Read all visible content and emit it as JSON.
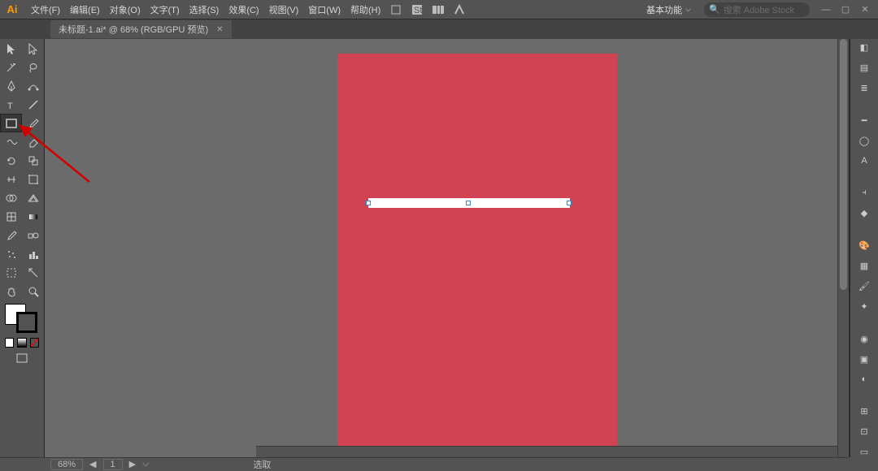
{
  "app_logo": "Ai",
  "menu": {
    "file": "文件(F)",
    "edit": "编辑(E)",
    "object": "对象(O)",
    "text": "文字(T)",
    "select": "选择(S)",
    "effect": "效果(C)",
    "view": "视图(V)",
    "window": "窗口(W)",
    "help": "帮助(H)"
  },
  "workspace_switch": "基本功能",
  "search_placeholder": "搜索 Adobe Stock",
  "tab_title": "未标题-1.ai* @ 68% (RGB/GPU 预览)",
  "status": {
    "zoom": "68%",
    "page": "1",
    "arrow_l": "◀",
    "arrow_r": "▶",
    "pages_menu": "⌵",
    "label": "选取"
  },
  "toolbox_names": [
    [
      "selection-tool",
      "direct-selection-tool"
    ],
    [
      "magic-wand-tool",
      "lasso-tool"
    ],
    [
      "pen-tool",
      "curvature-tool"
    ],
    [
      "text-tool",
      "line-tool"
    ],
    [
      "rectangle-tool",
      "paintbrush-tool"
    ],
    [
      "shaper-tool",
      "eraser-tool"
    ],
    [
      "rotate-tool",
      "scale-tool"
    ],
    [
      "width-tool",
      "free-transform-tool"
    ],
    [
      "shape-builder-tool",
      "perspective-grid-tool"
    ],
    [
      "mesh-tool",
      "gradient-tool"
    ],
    [
      "eyedropper-tool",
      "blend-tool"
    ],
    [
      "symbol-sprayer-tool",
      "column-graph-tool"
    ],
    [
      "artboard-tool",
      "slice-tool"
    ],
    [
      "hand-tool",
      "zoom-tool"
    ]
  ],
  "right_icons": [
    "layers-icon",
    "libraries-icon",
    "properties-icon",
    "stroke-icon",
    "circle-icon",
    "text-icon",
    "align-icon",
    "pathfinder-icon",
    "color-icon",
    "swatches-icon",
    "brushes-icon",
    "symbols-icon",
    "appearance-icon",
    "graphic-styles-icon",
    "transparency-icon",
    "info-icon",
    "navigator-icon",
    "artboards-icon"
  ],
  "colors": {
    "artboard": "#cf4352",
    "bar": "#ffffff"
  }
}
